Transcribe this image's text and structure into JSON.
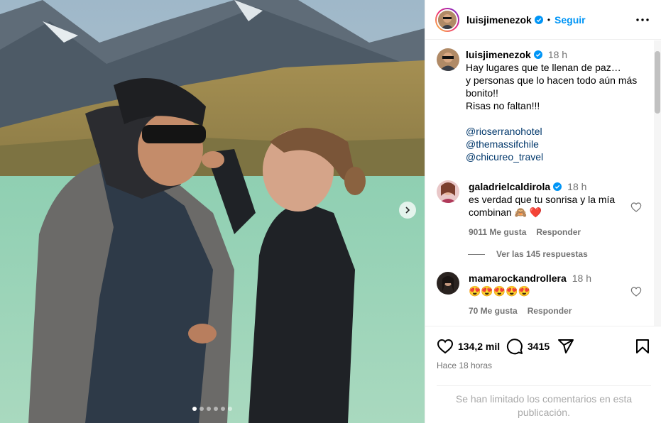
{
  "post": {
    "username": "luisjimenezok",
    "follow_label": "Seguir",
    "bullet": "•",
    "caption_time": "18 h",
    "caption_lines": [
      "Hay lugares que te llenan de paz…",
      "y personas que lo hacen todo aún más bonito!!",
      "Risas no faltan!!!"
    ],
    "mentions": [
      "@rioserranohotel",
      "@themassifchile",
      "@chicureo_travel"
    ]
  },
  "comments": [
    {
      "username": "galadrielcaldirola",
      "time": "18 h",
      "text": "es verdad que tu sonrisa y la mía combinan 🙈 ❤️",
      "likes": "9011 Me gusta",
      "reply_label": "Responder",
      "view_replies": "Ver las 145 respuestas"
    },
    {
      "username": "mamarockandrollera",
      "time": "18 h",
      "text": "😍😍😍😍😍",
      "likes": "70 Me gusta",
      "reply_label": "Responder"
    }
  ],
  "actions": {
    "like_count": "134,2 mil",
    "comment_count": "3415",
    "posted_ago": "Hace 18 horas"
  },
  "comments_limited": "Se han limitado los comentarios en esta publicación.",
  "carousel": {
    "count": 6,
    "active_index": 0
  },
  "colors": {
    "accent": "#0095f6",
    "mention": "#00376b",
    "verified": "#0095f6",
    "lake": "#8dc9ad"
  },
  "icons": [
    "more-options-icon",
    "verified-icon",
    "heart-icon",
    "comment-icon",
    "share-icon",
    "save-icon",
    "chevron-right-icon"
  ]
}
